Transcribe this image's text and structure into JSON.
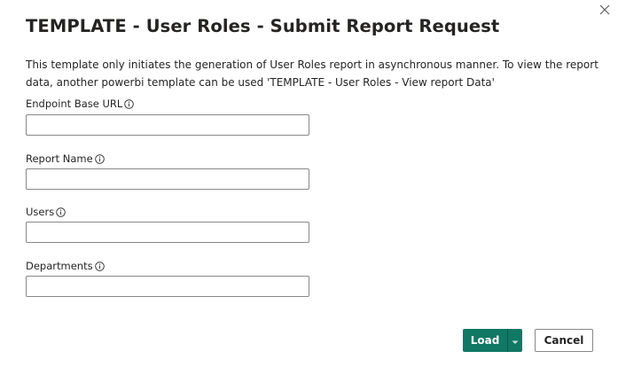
{
  "dialog": {
    "title": "TEMPLATE - User Roles - Submit Report Request",
    "description": "This template only initiates the generation of User Roles report in asynchronous manner. To view the report data, another powerbi template can be used 'TEMPLATE - User Roles - View report Data'",
    "close_icon": "close-icon"
  },
  "fields": [
    {
      "label": "Endpoint Base URL",
      "value": "",
      "info_icon": "info-icon"
    },
    {
      "label": "Report Name",
      "value": "",
      "info_icon": "info-icon"
    },
    {
      "label": "Users",
      "value": "",
      "info_icon": "info-icon"
    },
    {
      "label": "Departments",
      "value": "",
      "info_icon": "info-icon"
    }
  ],
  "footer": {
    "load_label": "Load",
    "load_dropdown_icon": "chevron-down-icon",
    "cancel_label": "Cancel"
  },
  "colors": {
    "primary": "#117865",
    "text": "#252423",
    "input_border": "#8a8886"
  }
}
